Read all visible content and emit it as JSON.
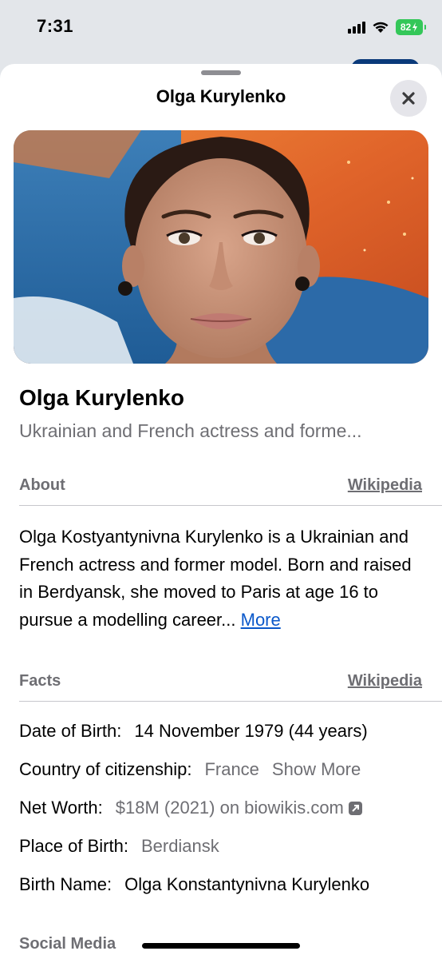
{
  "status_bar": {
    "time": "7:31",
    "battery": "82"
  },
  "sheet": {
    "title": "Olga Kurylenko",
    "close_icon": "close-icon"
  },
  "header": {
    "name": "Olga Kurylenko",
    "description": "Ukrainian and French actress and forme..."
  },
  "about": {
    "label": "About",
    "source_link": "Wikipedia",
    "text": "Olga Kostyantynivna Kurylenko is a Ukrainian and French actress and former model. Born and raised in Berdyansk, she moved to Paris at age 16 to pursue a modelling career...",
    "more_label": "More"
  },
  "facts": {
    "label": "Facts",
    "source_link": "Wikipedia",
    "rows": [
      {
        "label": "Date of Birth:",
        "value": "14 November 1979 (44 years)"
      },
      {
        "label": "Country of citizenship:",
        "value": "France",
        "extra": "Show More"
      },
      {
        "label": "Net Worth:",
        "value": "$18M (2021) on biowikis.com"
      },
      {
        "label": "Place of Birth:",
        "value": "Berdiansk"
      },
      {
        "label": "Birth Name:",
        "value": "Olga Konstantynivna Kurylenko"
      }
    ]
  },
  "social": {
    "label": "Social Media"
  },
  "colors": {
    "link_blue": "#0a58ca",
    "secondary_gray": "#6e6e73",
    "battery_green": "#34c759"
  }
}
